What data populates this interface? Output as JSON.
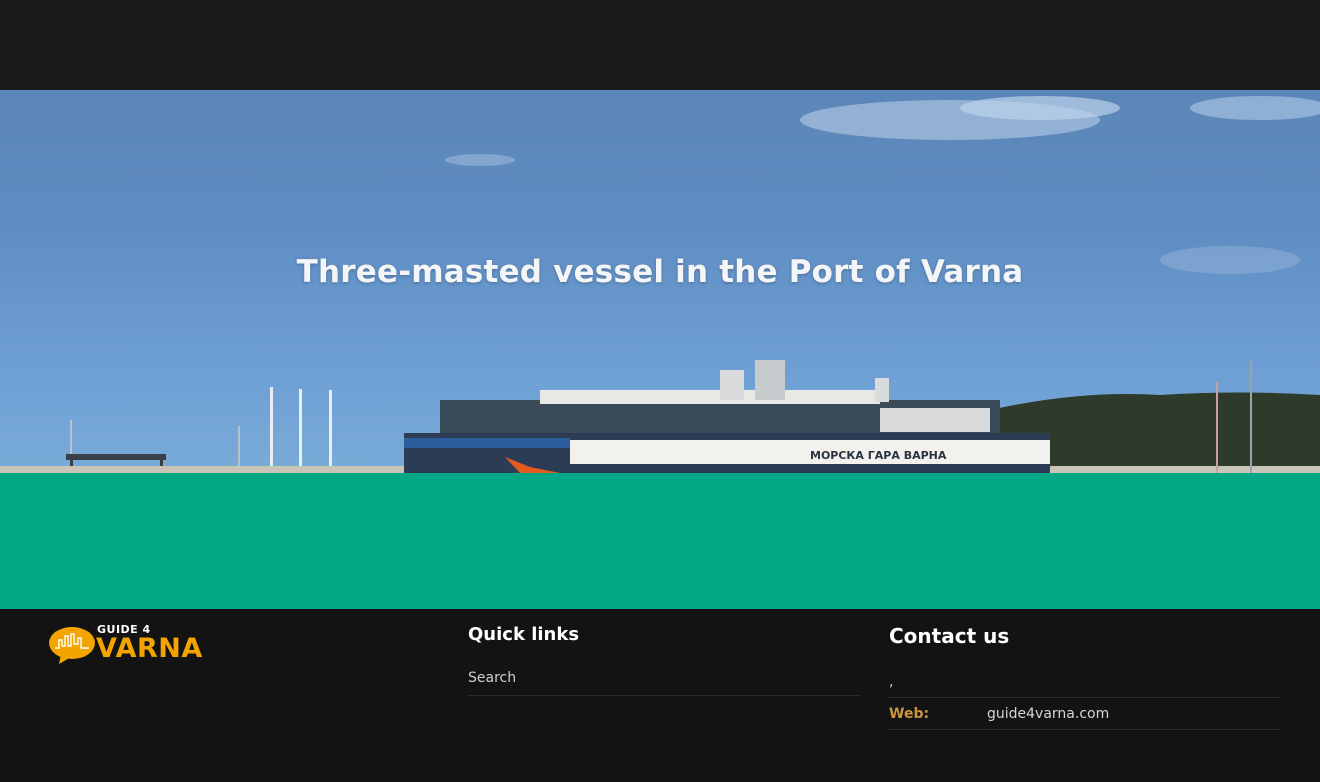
{
  "hero": {
    "title": "Three-masted vessel in the Port of Varna",
    "building_sign": "МОРСКА ГАРА ВАРНА"
  },
  "footer": {
    "logo": {
      "top_text": "GUIDE 4",
      "main_text": "VARNA"
    },
    "quick_links": {
      "title": "Quick links",
      "items": [
        {
          "label": "Search"
        }
      ]
    },
    "contact": {
      "title": "Contact us",
      "address_line": ",",
      "web_label": "Web:",
      "web_value": "guide4varna.com"
    }
  },
  "colors": {
    "topbar": "#1b1b1c",
    "band": "#02a886",
    "footer_bg": "#131313",
    "logo_accent": "#f3a400",
    "label_accent": "#c9963e"
  }
}
